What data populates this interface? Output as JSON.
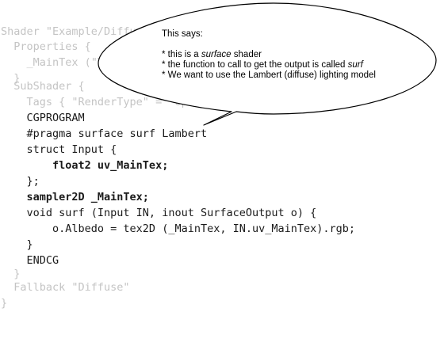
{
  "code_lines": [
    "Shader \"Example/Diffuse Simple\" {",
    "  Properties {",
    "    _MainTex (\"Texture\", 2D) = \"white\" {}",
    "  }",
    "  SubShader {",
    "    Tags { \"RenderType\" = \"Opaque\" }",
    "    CGPROGRAM",
    "    #pragma surface surf Lambert",
    "    struct Input {",
    "        float2 uv_MainTex;",
    "    };",
    "    sampler2D _MainTex;",
    "    void surf (Input IN, inout SurfaceOutput o) {",
    "        o.Albedo = tex2D (_MainTex, IN.uv_MainTex).rgb;",
    "    }",
    "    ENDCG",
    "  }",
    "  Fallback \"Diffuse\"",
    "}"
  ],
  "callout": {
    "intro": "This says:",
    "point1_pre": "* this is a ",
    "point1_em": "surface",
    "point1_post": " shader",
    "point2_pre": "* the function to call to get the output is called ",
    "point2_em": "surf",
    "point3": "* We want to use the Lambert (diffuse) lighting model"
  },
  "colors": {
    "dim_text": "#c4c4c4",
    "highlight_text": "#1a1a1a",
    "bubble_fill": "#ffffff",
    "bubble_stroke": "#000000"
  }
}
